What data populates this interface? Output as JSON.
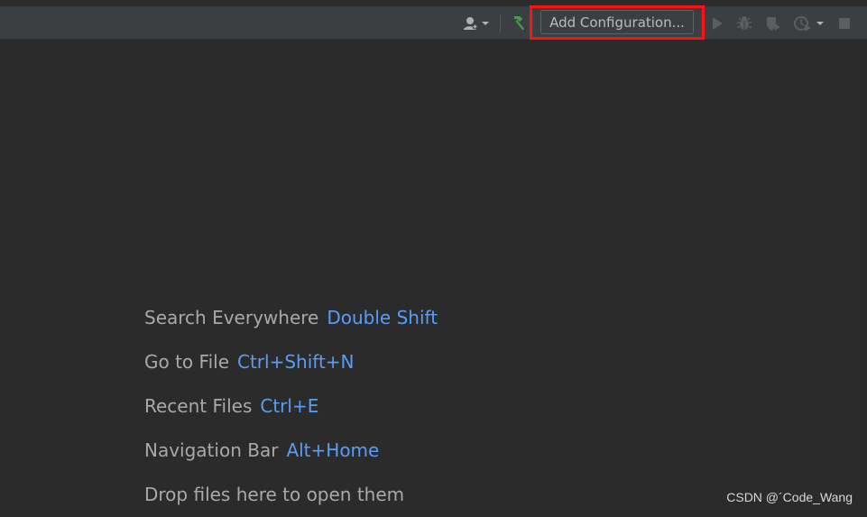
{
  "toolbar": {
    "user_icon": "user-icon",
    "build_icon": "hammer-icon",
    "add_configuration_label": "Add Configuration...",
    "run_icon": "play-icon",
    "debug_icon": "bug-icon",
    "coverage_icon": "shield-run-icon",
    "profile_icon": "profile-run-icon",
    "stop_icon": "stop-icon",
    "highlight_color": "#ff1111",
    "build_icon_color": "#499c54"
  },
  "hints": [
    {
      "label": "Search Everywhere",
      "shortcut": "Double Shift"
    },
    {
      "label": "Go to File",
      "shortcut": "Ctrl+Shift+N"
    },
    {
      "label": "Recent Files",
      "shortcut": "Ctrl+E"
    },
    {
      "label": "Navigation Bar",
      "shortcut": "Alt+Home"
    },
    {
      "label": "Drop files here to open them",
      "shortcut": ""
    }
  ],
  "watermark": "CSDN @´Code_Wang",
  "colors": {
    "background": "#2b2b2b",
    "toolbar": "#3c3f41",
    "hint_text": "#a9a9a9",
    "shortcut_text": "#589df6"
  }
}
